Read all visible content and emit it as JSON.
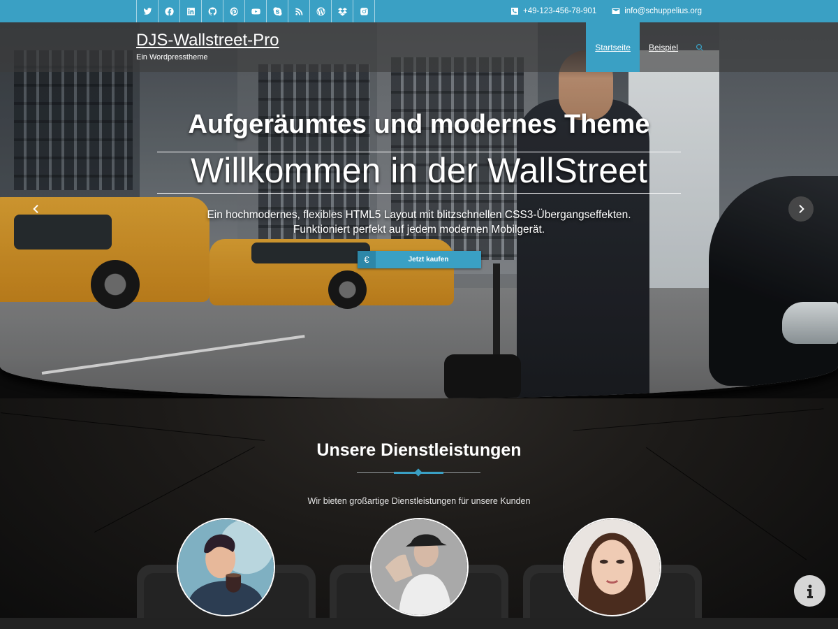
{
  "topbar": {
    "social": [
      {
        "icon": "twitter-icon"
      },
      {
        "icon": "facebook-icon"
      },
      {
        "icon": "linkedin-icon"
      },
      {
        "icon": "github-icon"
      },
      {
        "icon": "pinterest-icon"
      },
      {
        "icon": "youtube-icon"
      },
      {
        "icon": "skype-icon"
      },
      {
        "icon": "rss-icon"
      },
      {
        "icon": "wordpress-icon"
      },
      {
        "icon": "dropbox-icon"
      },
      {
        "icon": "instagram-icon"
      }
    ],
    "phone": "+49-123-456-78-901",
    "email": "info@schuppelius.org",
    "accent_color": "#3aa0c4"
  },
  "header": {
    "site_title": "DJS-Wallstreet-Pro",
    "tagline": "Ein Wordpresstheme",
    "nav": [
      {
        "label": "Startseite",
        "active": true
      },
      {
        "label": "Beispiel",
        "active": false
      }
    ],
    "search_icon": "search-icon"
  },
  "slider": {
    "kicker": "Aufgeräumtes und modernes Theme",
    "title": "Willkommen in der WallStreet",
    "description_line1": "Ein hochmodernes, flexibles HTML5 Layout mit blitzschnellen CSS3-Übergangseffekten.",
    "description_line2": "Funktioniert perfekt auf jedem modernen Mobilgerät.",
    "cta_icon": "€",
    "cta_label": "Jetzt kaufen",
    "prev_icon": "chevron-left-icon",
    "next_icon": "chevron-right-icon"
  },
  "services": {
    "title": "Unsere Dienstleistungen",
    "subtitle": "Wir bieten großartige Dienstleistungen für unsere Kunden",
    "cards": [
      {
        "avatar": "woman-with-cup-photo"
      },
      {
        "avatar": "dancer-with-cap-photo"
      },
      {
        "avatar": "woman-portrait-photo"
      }
    ]
  },
  "info_button": {
    "icon": "info-icon"
  }
}
